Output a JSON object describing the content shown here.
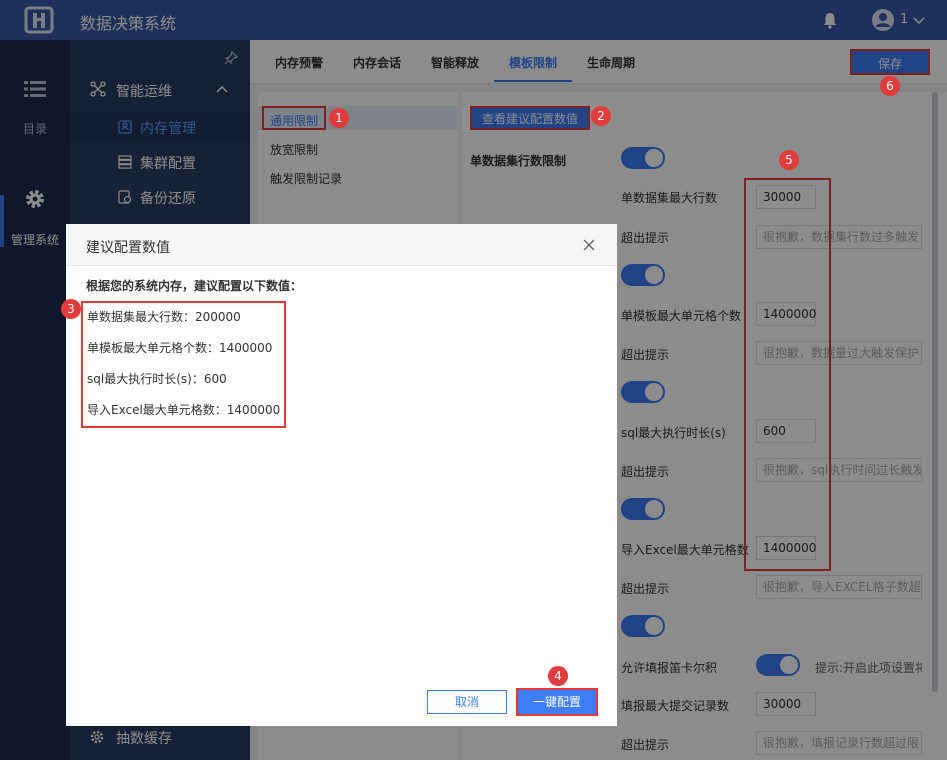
{
  "app": {
    "title": "数据决策系统",
    "user": "1"
  },
  "rail": {
    "directory_label": "目录",
    "system_label": "管理系统"
  },
  "sidebar": {
    "group_label": "智能运维",
    "items": [
      {
        "label": "内存管理"
      },
      {
        "label": "集群配置"
      },
      {
        "label": "备份还原"
      }
    ],
    "bottom_item": "抽数缓存"
  },
  "tabs": [
    "内存预警",
    "内存会话",
    "智能释放",
    "模板限制",
    "生命周期"
  ],
  "save_label": "保存",
  "subnav": [
    "通用限制",
    "放宽限制",
    "触发限制记录"
  ],
  "content": {
    "suggest_button": "查看建议配置数值",
    "section_title": "单数据集行数限制",
    "fields": [
      {
        "label": "单数据集最大行数",
        "value": "30000",
        "tip_label": "超出提示",
        "tip": "很抱歉，数据集行数过多触发"
      },
      {
        "label": "单模板最大单元格个数",
        "value": "1400000",
        "tip_label": "超出提示",
        "tip": "很抱歉，数据量过大触发保护"
      },
      {
        "label": "sql最大执行时长(s)",
        "value": "600",
        "tip_label": "超出提示",
        "tip": "很抱歉，sql执行时间过长触发"
      },
      {
        "label": "导入Excel最大单元格数",
        "value": "1400000",
        "tip_label": "超出提示",
        "tip": "很抱歉，导入EXCEL格子数超"
      }
    ],
    "cartesian_label": "允许填报笛卡尔积",
    "cartesian_tip": "提示:开启此项设置将",
    "submit_label": "填报最大提交记录数",
    "submit_value": "30000",
    "submit_tip_label": "超出提示",
    "submit_tip": "很抱歉，填报记录行数超过限"
  },
  "dialog": {
    "title": "建议配置数值",
    "intro": "根据您的系统内存，建议配置以下数值：",
    "lines": [
      "单数据集最大行数：200000",
      "单模板最大单元格个数：1400000",
      "sql最大执行时长(s)：600",
      "导入Excel最大单元格数：1400000"
    ],
    "cancel": "取消",
    "apply": "一键配置"
  },
  "badges": [
    "1",
    "2",
    "3",
    "4",
    "5",
    "6"
  ],
  "colors": {
    "brand": "#3a5aa5",
    "accent": "#3d7df6",
    "highlight": "#e23b3b",
    "rail": "#1c2d4d",
    "sidebar": "#2a3d63"
  }
}
